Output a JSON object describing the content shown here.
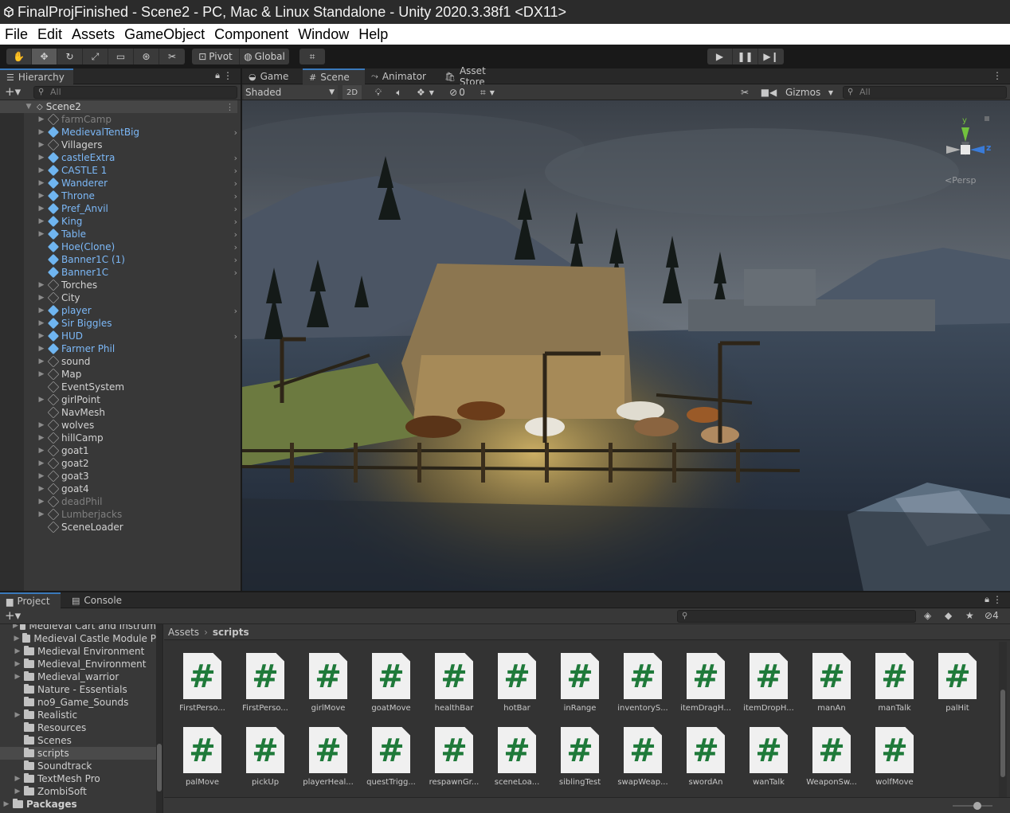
{
  "window": {
    "title": "FinalProjFinished - Scene2 - PC, Mac & Linux Standalone - Unity 2020.3.38f1 <DX11>"
  },
  "menu": [
    "File",
    "Edit",
    "Assets",
    "GameObject",
    "Component",
    "Window",
    "Help"
  ],
  "toolbar": {
    "pivot_label": "Pivot",
    "global_label": "Global"
  },
  "hierarchy": {
    "tab_label": "Hierarchy",
    "search_placeholder": "All",
    "scene_name": "Scene2",
    "items": [
      {
        "label": "farmCamp",
        "kind": "go",
        "state": "inactive",
        "foldable": true,
        "has_arrow": false
      },
      {
        "label": "MedievalTentBig",
        "kind": "prefab",
        "state": "prefab",
        "foldable": true,
        "has_arrow": true
      },
      {
        "label": "Villagers",
        "kind": "go",
        "state": "normal",
        "foldable": true,
        "has_arrow": false
      },
      {
        "label": "castleExtra",
        "kind": "prefab",
        "state": "prefab",
        "foldable": true,
        "has_arrow": true
      },
      {
        "label": "CASTLE 1",
        "kind": "prefab",
        "state": "prefab",
        "foldable": true,
        "has_arrow": true
      },
      {
        "label": "Wanderer",
        "kind": "prefab",
        "state": "prefab",
        "foldable": true,
        "has_arrow": true
      },
      {
        "label": "Throne",
        "kind": "prefab",
        "state": "prefab",
        "foldable": true,
        "has_arrow": true
      },
      {
        "label": "Pref_Anvil",
        "kind": "prefab",
        "state": "prefab",
        "foldable": true,
        "has_arrow": true
      },
      {
        "label": "King",
        "kind": "prefab",
        "state": "prefab",
        "foldable": true,
        "has_arrow": true
      },
      {
        "label": "Table",
        "kind": "prefab",
        "state": "prefab",
        "foldable": true,
        "has_arrow": true
      },
      {
        "label": "Hoe(Clone)",
        "kind": "prefab",
        "state": "prefab",
        "foldable": false,
        "has_arrow": true
      },
      {
        "label": "Banner1C (1)",
        "kind": "prefab",
        "state": "prefab",
        "foldable": false,
        "has_arrow": true
      },
      {
        "label": "Banner1C",
        "kind": "prefab",
        "state": "prefab",
        "foldable": false,
        "has_arrow": true
      },
      {
        "label": "Torches",
        "kind": "go",
        "state": "normal",
        "foldable": true,
        "has_arrow": false
      },
      {
        "label": "City",
        "kind": "go",
        "state": "normal",
        "foldable": true,
        "has_arrow": false
      },
      {
        "label": "player",
        "kind": "prefab",
        "state": "prefab",
        "foldable": true,
        "has_arrow": true
      },
      {
        "label": "Sir Biggles",
        "kind": "prefab",
        "state": "prefab",
        "foldable": true,
        "has_arrow": false
      },
      {
        "label": "HUD",
        "kind": "prefab",
        "state": "prefab",
        "foldable": true,
        "has_arrow": true
      },
      {
        "label": "Farmer Phil",
        "kind": "prefab",
        "state": "prefab",
        "foldable": true,
        "has_arrow": false
      },
      {
        "label": "sound",
        "kind": "go",
        "state": "normal",
        "foldable": true,
        "has_arrow": false
      },
      {
        "label": "Map",
        "kind": "go",
        "state": "normal",
        "foldable": true,
        "has_arrow": false
      },
      {
        "label": "EventSystem",
        "kind": "go",
        "state": "normal",
        "foldable": false,
        "has_arrow": false
      },
      {
        "label": "girlPoint",
        "kind": "go",
        "state": "normal",
        "foldable": true,
        "has_arrow": false
      },
      {
        "label": "NavMesh",
        "kind": "go",
        "state": "normal",
        "foldable": false,
        "has_arrow": false
      },
      {
        "label": "wolves",
        "kind": "go",
        "state": "normal",
        "foldable": true,
        "has_arrow": false
      },
      {
        "label": "hillCamp",
        "kind": "go",
        "state": "normal",
        "foldable": true,
        "has_arrow": false
      },
      {
        "label": "goat1",
        "kind": "go",
        "state": "normal",
        "foldable": true,
        "has_arrow": false
      },
      {
        "label": "goat2",
        "kind": "go",
        "state": "normal",
        "foldable": true,
        "has_arrow": false
      },
      {
        "label": "goat3",
        "kind": "go",
        "state": "normal",
        "foldable": true,
        "has_arrow": false
      },
      {
        "label": "goat4",
        "kind": "go",
        "state": "normal",
        "foldable": true,
        "has_arrow": false
      },
      {
        "label": "deadPhil",
        "kind": "go",
        "state": "inactive",
        "foldable": true,
        "has_arrow": false
      },
      {
        "label": "Lumberjacks",
        "kind": "go",
        "state": "inactive",
        "foldable": true,
        "has_arrow": false
      },
      {
        "label": "SceneLoader",
        "kind": "go",
        "state": "normal",
        "foldable": false,
        "has_arrow": false
      }
    ]
  },
  "scene_tabs": {
    "game": "Game",
    "scene": "Scene",
    "animator": "Animator",
    "asset_store": "Asset Store"
  },
  "scene_toolbar": {
    "shading": "Shaded",
    "mode_2d": "2D",
    "hidden_count": "0",
    "gizmos": "Gizmos",
    "search_placeholder": "All"
  },
  "gizmo": {
    "y": "y",
    "z": "z",
    "persp": "Persp"
  },
  "bottom_tabs": {
    "project": "Project",
    "console": "Console"
  },
  "project": {
    "layer_count": "4",
    "folders": [
      {
        "label": "Medieval Cart and Instrum",
        "foldable": true,
        "selected": false,
        "indent": 1,
        "clipped": true
      },
      {
        "label": "Medieval Castle Module P",
        "foldable": true,
        "selected": false,
        "indent": 1,
        "clipped": false
      },
      {
        "label": "Medieval Environment",
        "foldable": true,
        "selected": false,
        "indent": 1,
        "clipped": false
      },
      {
        "label": "Medieval_Environment",
        "foldable": true,
        "selected": false,
        "indent": 1,
        "clipped": false
      },
      {
        "label": "Medieval_warrior",
        "foldable": true,
        "selected": false,
        "indent": 1,
        "clipped": false
      },
      {
        "label": "Nature - Essentials",
        "foldable": false,
        "selected": false,
        "indent": 1,
        "clipped": false
      },
      {
        "label": "no9_Game_Sounds",
        "foldable": false,
        "selected": false,
        "indent": 1,
        "clipped": false
      },
      {
        "label": "Realistic",
        "foldable": true,
        "selected": false,
        "indent": 1,
        "clipped": false
      },
      {
        "label": "Resources",
        "foldable": false,
        "selected": false,
        "indent": 1,
        "clipped": false
      },
      {
        "label": "Scenes",
        "foldable": false,
        "selected": false,
        "indent": 1,
        "clipped": false
      },
      {
        "label": "scripts",
        "foldable": false,
        "selected": true,
        "indent": 1,
        "clipped": false
      },
      {
        "label": "Soundtrack",
        "foldable": false,
        "selected": false,
        "indent": 1,
        "clipped": false
      },
      {
        "label": "TextMesh Pro",
        "foldable": true,
        "selected": false,
        "indent": 1,
        "clipped": false
      },
      {
        "label": "ZombiSoft",
        "foldable": true,
        "selected": false,
        "indent": 1,
        "clipped": false
      },
      {
        "label": "Packages",
        "foldable": true,
        "selected": false,
        "indent": 0,
        "clipped": false
      }
    ],
    "breadcrumb": [
      "Assets",
      "scripts"
    ],
    "assets_row1": [
      "FirstPerso...",
      "FirstPerso...",
      "girlMove",
      "goatMove",
      "healthBar",
      "hotBar",
      "inRange",
      "inventoryS...",
      "itemDragH...",
      "itemDropH...",
      "manAn",
      "manTalk",
      "palHit"
    ],
    "assets_row2": [
      "palMove",
      "pickUp",
      "playerHeal...",
      "questTrigg...",
      "respawnGr...",
      "sceneLoa...",
      "siblingTest",
      "swapWeap...",
      "swordAn",
      "wanTalk",
      "WeaponSw...",
      "wolfMove"
    ]
  }
}
